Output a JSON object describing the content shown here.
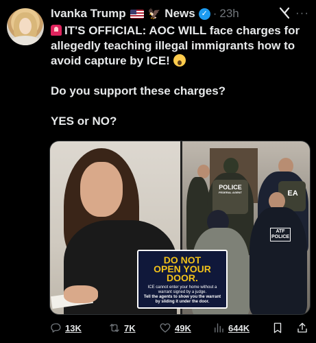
{
  "post": {
    "author_name": "Ivanka Trump",
    "author_suffix": "News",
    "separator": "·",
    "time": "23h",
    "more_label": "···",
    "text_line1": "IT'S OFFICIAL: AOC WILL face charges for allegedly teaching illegal immigrants how to avoid capture by ICE!",
    "text_line2": "Do you support these charges?",
    "text_line3": "YES or NO?"
  },
  "media": {
    "sign_title": "DO NOT\nOPEN YOUR\nDOOR.",
    "sign_body": "ICE cannot enter your home without a warrant signed by a judge.",
    "sign_body2": "Tell the agents to show you the warrant by sliding it under the door.",
    "badge_police": "POLICE",
    "badge_police_sub": "FEDERAL AGENT",
    "badge_ea": "EA",
    "badge_atf": "ATF",
    "badge_atf_police": "POLICE"
  },
  "actions": {
    "replies": "13K",
    "reposts": "7K",
    "likes": "49K",
    "views": "644K"
  },
  "colors": {
    "background": "#000000",
    "text": "#e7e9ea",
    "muted": "#71767b",
    "verified": "#1d9bf0",
    "sign_yellow": "#f2c21a"
  },
  "icons": [
    "siren-emoji",
    "scream-emoji",
    "us-flag-emoji",
    "eagle-emoji",
    "verified-icon",
    "grok-icon",
    "more-icon",
    "reply-icon",
    "repost-icon",
    "like-icon",
    "views-icon",
    "bookmark-icon",
    "share-icon"
  ]
}
